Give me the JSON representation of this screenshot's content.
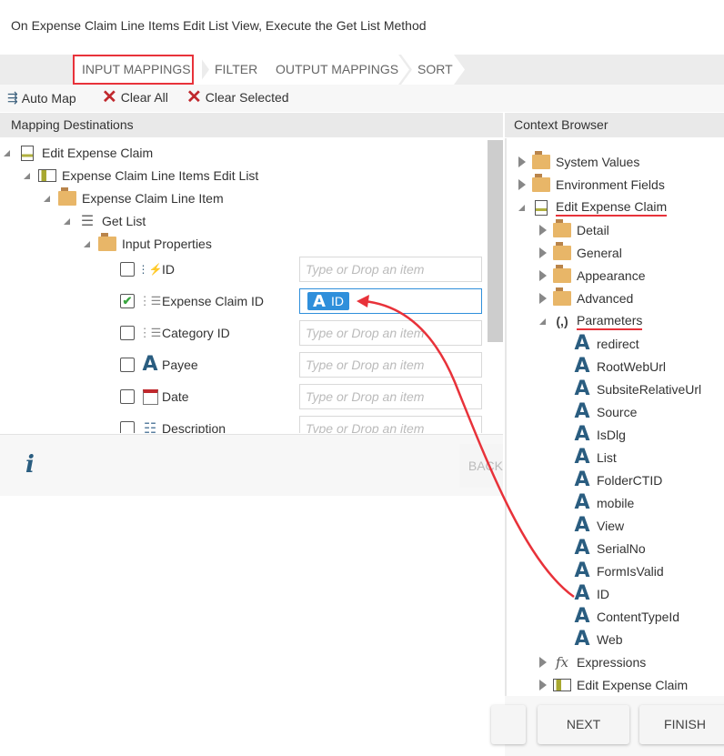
{
  "title": "On Expense Claim Line Items Edit List View, Execute the Get List Method",
  "tabs": [
    "INPUT MAPPINGS",
    "FILTER",
    "OUTPUT MAPPINGS",
    "SORT"
  ],
  "toolbar": {
    "auto_map": "Auto Map",
    "clear_all": "Clear All",
    "clear_selected": "Clear Selected"
  },
  "left": {
    "header": "Mapping Destinations",
    "tree": [
      {
        "label": "Edit Expense Claim",
        "icon": "form-icon"
      },
      {
        "label": "Expense Claim Line Items Edit List",
        "icon": "list-view-icon"
      },
      {
        "label": "Expense Claim Line Item",
        "icon": "folder-icon"
      },
      {
        "label": "Get List",
        "icon": "method-icon"
      },
      {
        "label": "Input Properties",
        "icon": "folder-icon"
      }
    ],
    "fields": [
      {
        "label": "ID",
        "icon": "autonumber-icon",
        "checked": false,
        "value": "",
        "placeholder": "Type or Drop an item"
      },
      {
        "label": "Expense Claim ID",
        "icon": "number-icon",
        "checked": true,
        "value": "ID",
        "placeholder": ""
      },
      {
        "label": "Category ID",
        "icon": "number-icon",
        "checked": false,
        "value": "",
        "placeholder": "Type or Drop an item"
      },
      {
        "label": "Payee",
        "icon": "text-icon",
        "checked": false,
        "value": "",
        "placeholder": "Type or Drop an item"
      },
      {
        "label": "Date",
        "icon": "calendar-icon",
        "checked": false,
        "value": "",
        "placeholder": "Type or Drop an item"
      },
      {
        "label": "Description",
        "icon": "memo-icon",
        "checked": false,
        "value": "",
        "placeholder": "Type or Drop an item"
      }
    ]
  },
  "info_icon": "i",
  "back_label": "BACK",
  "right": {
    "header": "Context Browser",
    "tree": [
      {
        "label": "System Values",
        "level": 0,
        "icon": "folder-icon",
        "state": "collapsed"
      },
      {
        "label": "Environment Fields",
        "level": 0,
        "icon": "folder-icon",
        "state": "collapsed"
      },
      {
        "label": "Edit Expense Claim",
        "level": 0,
        "icon": "form-icon",
        "state": "expanded",
        "underline": true
      },
      {
        "label": "Detail",
        "level": 1,
        "icon": "folder-icon",
        "state": "collapsed"
      },
      {
        "label": "General",
        "level": 1,
        "icon": "folder-icon",
        "state": "collapsed"
      },
      {
        "label": "Appearance",
        "level": 1,
        "icon": "folder-icon",
        "state": "collapsed"
      },
      {
        "label": "Advanced",
        "level": 1,
        "icon": "folder-icon",
        "state": "collapsed"
      },
      {
        "label": "Parameters",
        "level": 1,
        "icon": "parameters-icon",
        "state": "expanded",
        "underline": true
      },
      {
        "label": "redirect",
        "level": 2,
        "icon": "text-icon"
      },
      {
        "label": "RootWebUrl",
        "level": 2,
        "icon": "text-icon"
      },
      {
        "label": "SubsiteRelativeUrl",
        "level": 2,
        "icon": "text-icon"
      },
      {
        "label": "Source",
        "level": 2,
        "icon": "text-icon"
      },
      {
        "label": "IsDlg",
        "level": 2,
        "icon": "text-icon"
      },
      {
        "label": "List",
        "level": 2,
        "icon": "text-icon"
      },
      {
        "label": "FolderCTID",
        "level": 2,
        "icon": "text-icon"
      },
      {
        "label": "mobile",
        "level": 2,
        "icon": "text-icon"
      },
      {
        "label": "View",
        "level": 2,
        "icon": "text-icon"
      },
      {
        "label": "SerialNo",
        "level": 2,
        "icon": "text-icon"
      },
      {
        "label": "FormIsValid",
        "level": 2,
        "icon": "text-icon"
      },
      {
        "label": "ID",
        "level": 2,
        "icon": "text-icon"
      },
      {
        "label": "ContentTypeId",
        "level": 2,
        "icon": "text-icon"
      },
      {
        "label": "Web",
        "level": 2,
        "icon": "text-icon"
      },
      {
        "label": "Expressions",
        "level": 1,
        "icon": "expression-icon",
        "state": "collapsed"
      },
      {
        "label": "Edit Expense Claim",
        "level": 1,
        "icon": "list-view-icon",
        "state": "collapsed"
      }
    ]
  },
  "buttons": {
    "next": "NEXT",
    "finish": "FINISH"
  },
  "colors": {
    "highlight": "#e8323a",
    "chip": "#2f8fdb",
    "accent": "#2a5d80"
  }
}
